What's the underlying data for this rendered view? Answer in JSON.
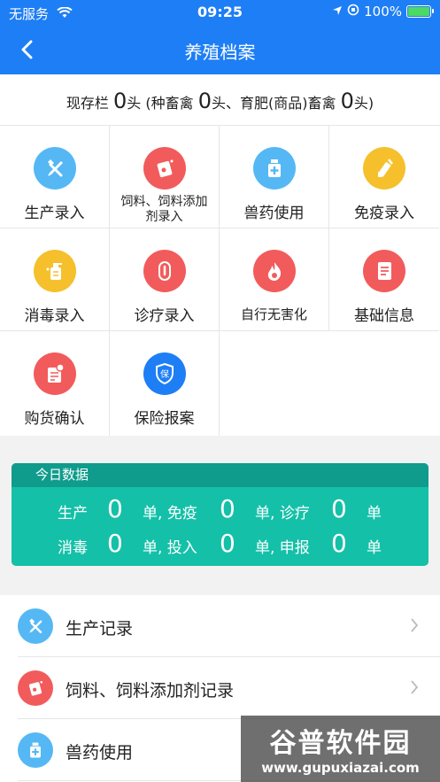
{
  "status": {
    "carrier": "无服务",
    "time": "09:25",
    "battery": "100%"
  },
  "nav": {
    "title": "养殖档案"
  },
  "stock": {
    "prefix": "现存栏",
    "total": "0",
    "part1": "头 (种畜禽",
    "breeding": "0",
    "part2": "头、育肥(商品)畜禽",
    "fattening": "0",
    "part3": "头)"
  },
  "grid": [
    {
      "label": "生产录入",
      "icon": "hammer-icon",
      "color": "#55b8f5"
    },
    {
      "label": "饲料、饲料添加剂录入",
      "icon": "feed-bag-icon",
      "color": "#f25b5b"
    },
    {
      "label": "兽药使用",
      "icon": "medicine-bottle-icon",
      "color": "#55b8f5"
    },
    {
      "label": "免疫录入",
      "icon": "syringe-icon",
      "color": "#f5c02b"
    },
    {
      "label": "消毒录入",
      "icon": "spray-bottle-icon",
      "color": "#f5c02b"
    },
    {
      "label": "诊疗录入",
      "icon": "thermometer-icon",
      "color": "#f25b5b"
    },
    {
      "label": "自行无害化",
      "icon": "flame-icon",
      "color": "#f25b5b"
    },
    {
      "label": "基础信息",
      "icon": "document-icon",
      "color": "#f25b5b"
    },
    {
      "label": "购货确认",
      "icon": "purchase-icon",
      "color": "#f25b5b"
    },
    {
      "label": "保险报案",
      "icon": "insurance-shield-icon",
      "color": "#1e7ef5"
    }
  ],
  "grid_icon_text": {
    "insurance": "保"
  },
  "today": {
    "title": "今日数据",
    "row1": {
      "a_label": "生产",
      "a_val": "0",
      "b_label": "单, 免疫",
      "b_val": "0",
      "c_label": "单, 诊疗",
      "c_val": "0",
      "d_label": "单"
    },
    "row2": {
      "a_label": "消毒",
      "a_val": "0",
      "b_label": "单, 投入",
      "b_val": "0",
      "c_label": "单, 申报",
      "c_val": "0",
      "d_label": "单"
    }
  },
  "records": [
    {
      "label": "生产记录",
      "icon": "hammer-icon",
      "color": "#55b8f5"
    },
    {
      "label": "饲料、饲料添加剂记录",
      "icon": "feed-bag-icon",
      "color": "#f25b5b"
    },
    {
      "label": "兽药使用",
      "icon": "medicine-bottle-icon",
      "color": "#55b8f5"
    }
  ],
  "watermark": {
    "name": "谷普软件园",
    "url": "www.gupuxiazai.com"
  }
}
